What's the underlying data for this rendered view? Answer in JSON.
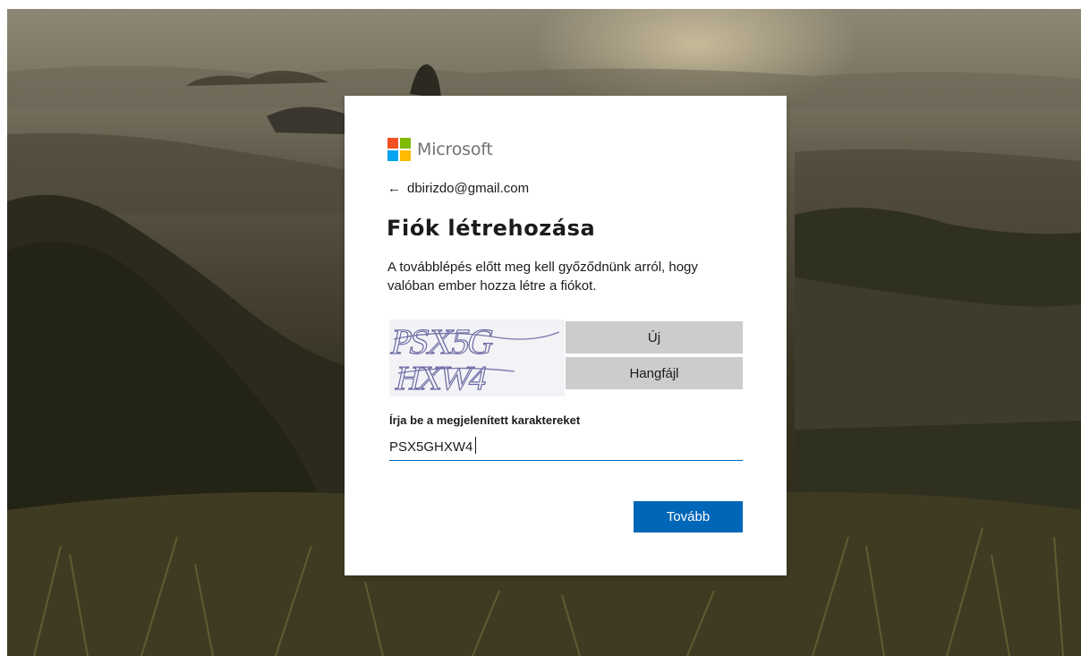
{
  "brand": {
    "name": "Microsoft",
    "logo_colors": [
      "#f25022",
      "#7fba00",
      "#00a4ef",
      "#ffb900"
    ]
  },
  "identity": {
    "back_icon": "arrow-left-icon",
    "back_glyph": "←",
    "email": "dbirizdo@gmail.com"
  },
  "title": "Fiók létrehozása",
  "description": "A továbblépés előtt meg kell győződnünk arról, hogy valóban ember hozza létre a fiókot.",
  "captcha": {
    "image_line1": "PSX5G",
    "image_line2": "HXW4",
    "new_button": "Új",
    "audio_button": "Hangfájl",
    "input_label": "Írja be a megjelenített karaktereket",
    "input_value": "PSX5GHXW4"
  },
  "next_button": "Tovább",
  "colors": {
    "accent": "#0067b8",
    "secondary_button": "#cccccc",
    "text": "#1b1b1b",
    "captcha_ink": "#6a6aa3"
  }
}
